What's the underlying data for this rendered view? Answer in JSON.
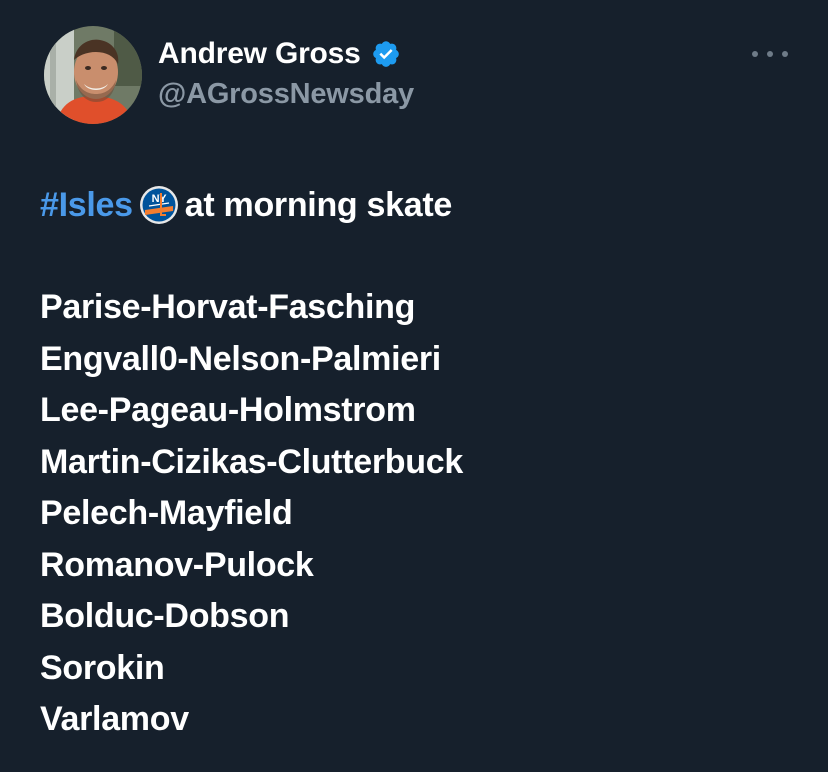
{
  "author": {
    "display_name": "Andrew Gross",
    "handle": "@AGrossNewsday",
    "verified": true
  },
  "tweet": {
    "hashtag": "#Isles",
    "headline_text": "at morning skate",
    "team_logo_icon": "ny-islanders-logo-icon",
    "lines": [
      "Parise-Horvat-Fasching",
      "Engvall0-Nelson-Palmieri",
      "Lee-Pageau-Holmstrom",
      "Martin-Cizikas-Clutterbuck",
      "Pelech-Mayfield",
      "Romanov-Pulock",
      "Bolduc-Dobson",
      "Sorokin",
      "Varlamov"
    ]
  },
  "colors": {
    "background": "#16202c",
    "hashtag": "#4a99e9",
    "handle": "#8b98a5",
    "verified_badge": "#1d9bf0"
  }
}
